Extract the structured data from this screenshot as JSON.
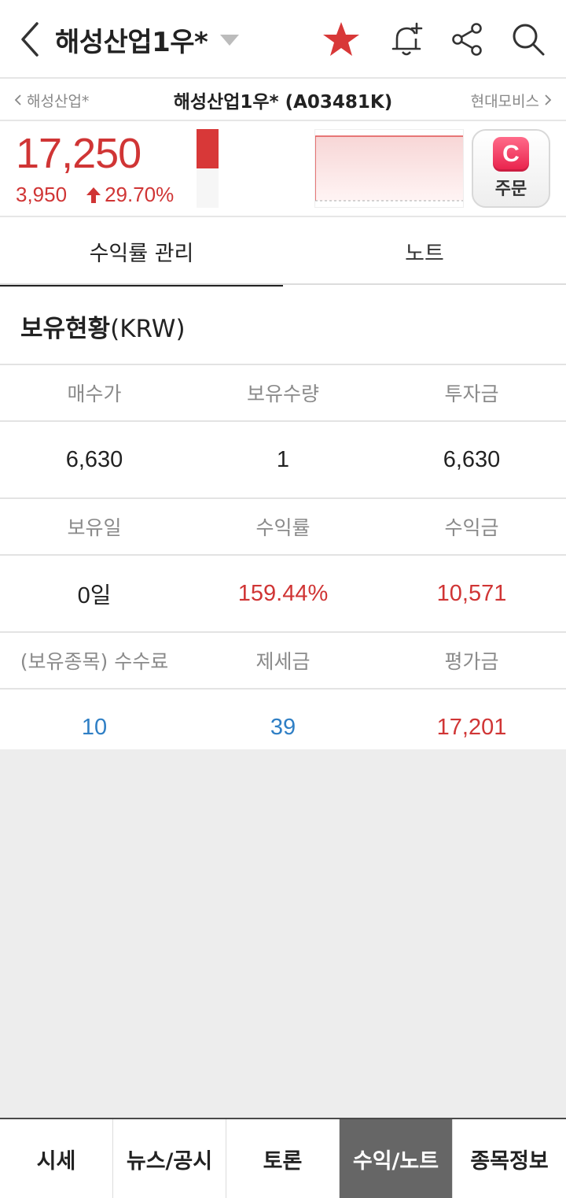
{
  "header": {
    "title": "해성산업1우*",
    "icons": [
      "back-icon",
      "dropdown-caret-icon",
      "star-icon",
      "alarm-add-icon",
      "share-icon",
      "search-icon"
    ],
    "star_color": "#d83838"
  },
  "subnav": {
    "prev_label": "해성산업*",
    "current_label": "해성산업1우* (A03481K)",
    "next_label": "현대모비스"
  },
  "quote": {
    "price": "17,250",
    "change": "3,950",
    "change_pct": "29.70%",
    "direction": "up",
    "day_range_level": 0.5,
    "up_color": "#d03535"
  },
  "order_button": {
    "label": "주문",
    "logo_letter": "C"
  },
  "tabs": [
    {
      "label": "수익률 관리",
      "active": true
    },
    {
      "label": "노트",
      "active": false
    }
  ],
  "holdings": {
    "title_main": "보유현황",
    "title_unit": "(KRW)",
    "rows": [
      {
        "headers": [
          "매수가",
          "보유수량",
          "투자금"
        ],
        "values": [
          "6,630",
          "1",
          "6,630"
        ]
      },
      {
        "headers": [
          "보유일",
          "수익률",
          "수익금"
        ],
        "values": [
          "0일",
          "159.44%",
          "10,571"
        ]
      },
      {
        "headers": [
          "(보유종목) 수수료",
          "제세금",
          "평가금"
        ],
        "values": [
          "10",
          "39",
          "17,201"
        ]
      }
    ]
  },
  "bottom_nav": [
    {
      "label": "시세",
      "active": false
    },
    {
      "label": "뉴스/공시",
      "active": false
    },
    {
      "label": "토론",
      "active": false
    },
    {
      "label": "수익/노트",
      "active": true
    },
    {
      "label": "종목정보",
      "active": false
    }
  ]
}
